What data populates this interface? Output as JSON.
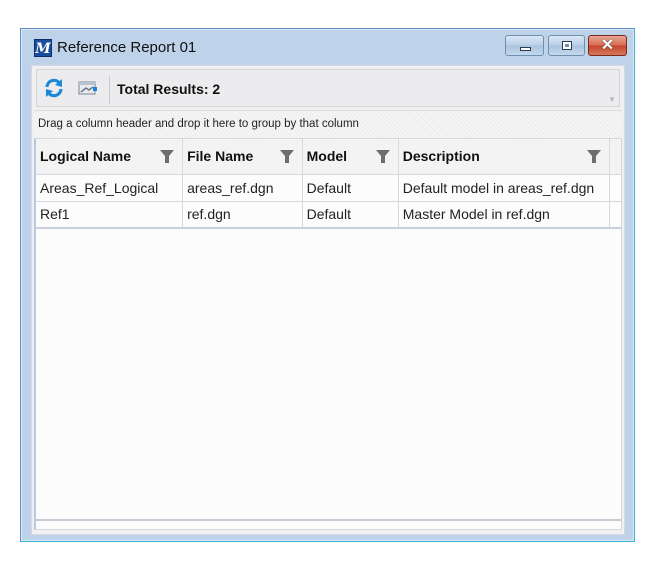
{
  "window": {
    "title": "Reference Report 01",
    "app_icon": "microstation-icon",
    "controls": [
      "minimize",
      "maximize",
      "close"
    ]
  },
  "toolbar": {
    "refresh_icon": "refresh-icon",
    "report_icon": "report-icon",
    "total_results": "Total Results: 2"
  },
  "groupbar": {
    "hint": "Drag a column header and drop it here to group by that column"
  },
  "table": {
    "columns": [
      {
        "label": "Logical Name",
        "filter_icon": "filter-icon"
      },
      {
        "label": "File Name",
        "filter_icon": "filter-icon"
      },
      {
        "label": "Model",
        "filter_icon": "filter-icon"
      },
      {
        "label": "Description",
        "filter_icon": "filter-icon"
      }
    ],
    "rows": [
      [
        "Areas_Ref_Logical",
        "areas_ref.dgn",
        "Default",
        "Default model in areas_ref.dgn"
      ],
      [
        "Ref1",
        "ref.dgn",
        "Default",
        "Master Model in ref.dgn"
      ]
    ]
  }
}
